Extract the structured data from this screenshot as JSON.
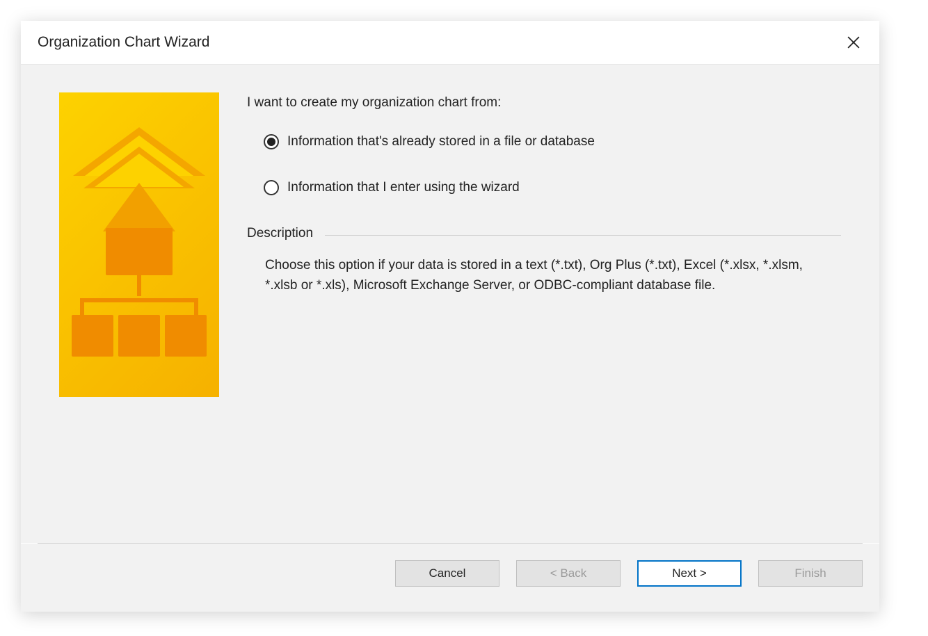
{
  "dialog": {
    "title": "Organization Chart Wizard",
    "prompt": "I want to create my organization chart from:",
    "options": [
      {
        "label": "Information that's already stored in a file or database",
        "selected": true
      },
      {
        "label": "Information that I enter using the wizard",
        "selected": false
      }
    ],
    "description": {
      "heading": "Description",
      "text": "Choose this option if your data is stored in a text (*.txt), Org Plus (*.txt), Excel (*.xlsx, *.xlsm, *.xlsb or *.xls), Microsoft Exchange Server, or ODBC-compliant database file."
    }
  },
  "buttons": {
    "cancel": "Cancel",
    "back": "< Back",
    "next": "Next >",
    "finish": "Finish"
  }
}
